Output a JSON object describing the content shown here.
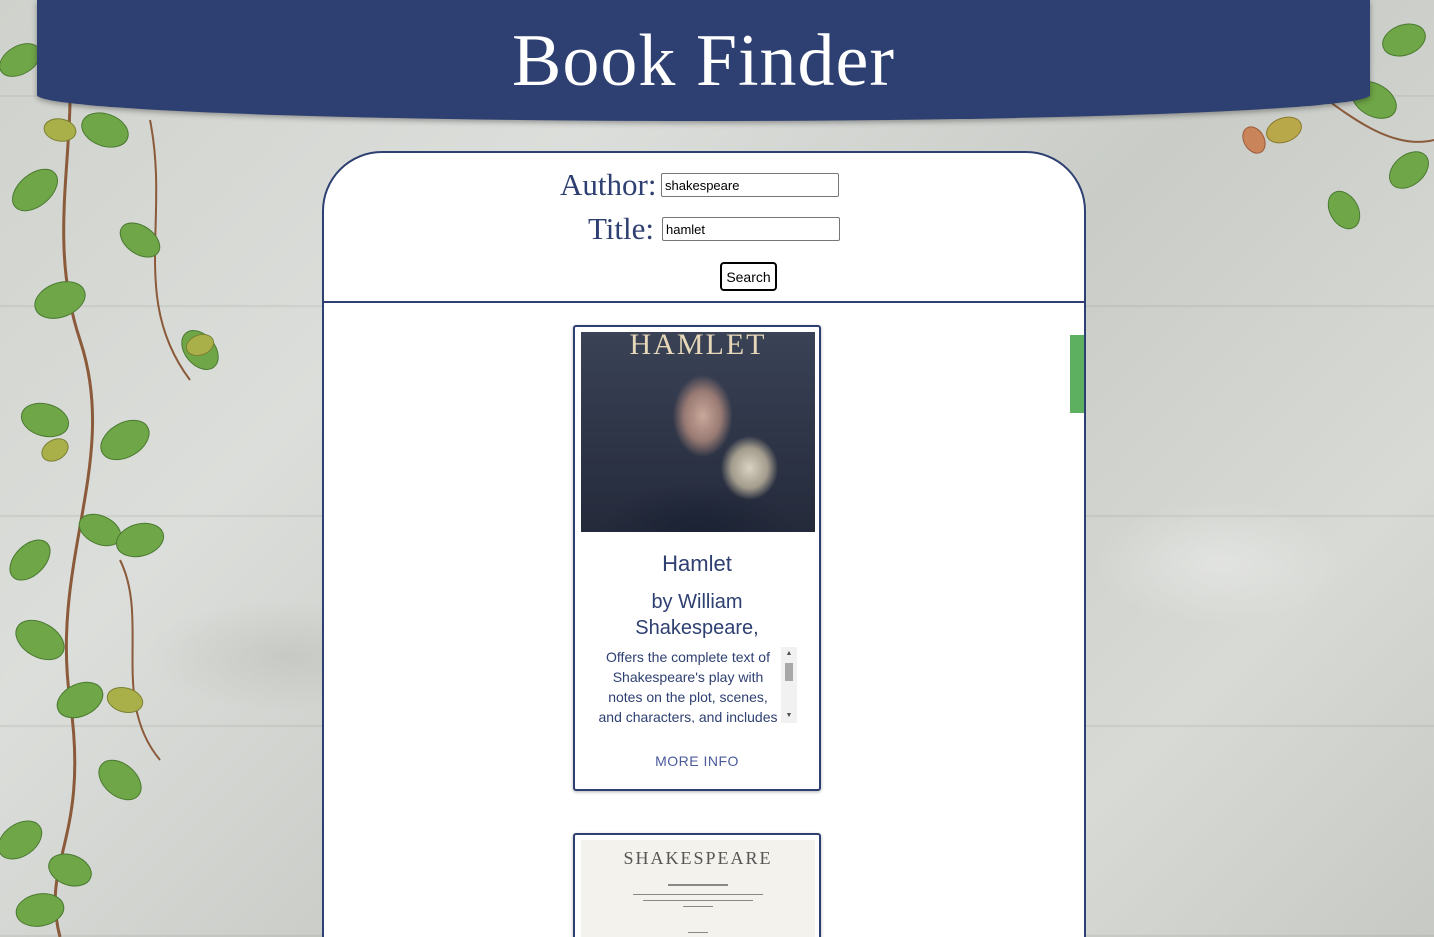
{
  "header": {
    "title": "Book Finder"
  },
  "search": {
    "author_label": "Author:",
    "author_value": "shakespeare",
    "title_label": "Title:",
    "title_value": "hamlet",
    "button_label": "Search"
  },
  "results": [
    {
      "cover_text": "HAMLET",
      "title": "Hamlet",
      "author": "by William Shakespeare,",
      "description": "Offers the complete text of Shakespeare's play with notes on the plot, scenes, and characters, and includes",
      "more_info_label": "MORE INFO"
    },
    {
      "cover_text": "SHAKESPEARE"
    }
  ],
  "colors": {
    "brand": "#2e4071",
    "accent_tab": "#5cb060",
    "link": "#4a5a9a"
  }
}
